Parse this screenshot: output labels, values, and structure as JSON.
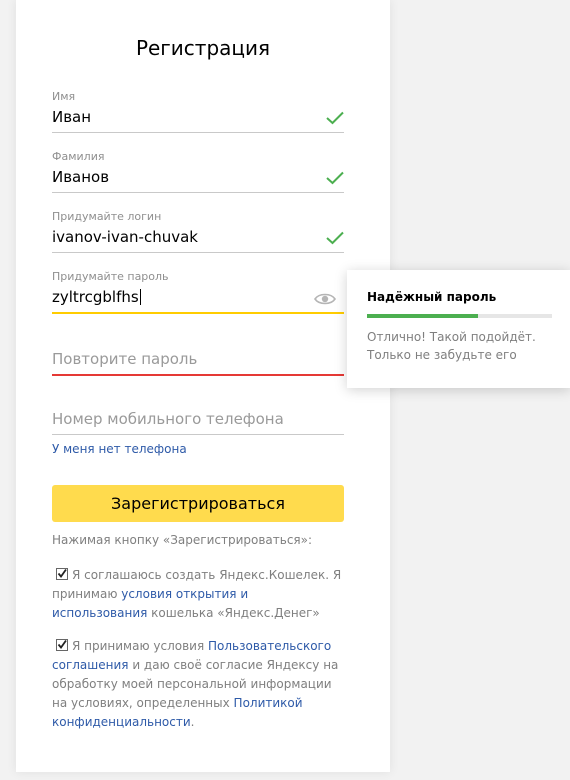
{
  "form": {
    "title": "Регистрация",
    "first_name": {
      "label": "Имя",
      "value": "Иван"
    },
    "last_name": {
      "label": "Фамилия",
      "value": "Иванов"
    },
    "login": {
      "label": "Придумайте логин",
      "value": "ivanov-ivan-chuvak"
    },
    "password": {
      "label": "Придумайте пароль",
      "value": "zyltrcgblfhs"
    },
    "repeat_password": {
      "placeholder": "Повторите пароль"
    },
    "phone": {
      "placeholder": "Номер мобильного телефона"
    },
    "no_phone_link": "У меня нет телефона",
    "submit_label": "Зарегистрироваться",
    "submit_note": "Нажимая кнопку «Зарегистрироваться»:",
    "agreement1": {
      "text_before": "Я соглашаюсь создать Яндекс.Кошелек. Я принимаю ",
      "link": "условия открытия и использования",
      "text_after": " кошелька «Яндекс.Денег»"
    },
    "agreement2": {
      "text_before": "Я принимаю условия ",
      "link1": "Пользовательского соглашения",
      "text_middle": " и даю своё согласие Яндексу на обработку моей персональной информации на условиях, определенных ",
      "link2": "Политикой конфиденциальности",
      "text_after": "."
    }
  },
  "password_popup": {
    "title": "Надёжный пароль",
    "strength": 0.6,
    "message_line1": "Отлично! Такой подойдёт.",
    "message_line2": "Только не забудьте его"
  },
  "icons": {
    "valid": "checkmark-icon",
    "toggle_password": "eye-icon",
    "checkbox": "checkbox-checked-icon"
  },
  "colors": {
    "accent": "#ffdb4d",
    "valid": "#4caf50",
    "error": "#e53935",
    "focus": "#ffcc00",
    "link": "#2e5aa8"
  }
}
